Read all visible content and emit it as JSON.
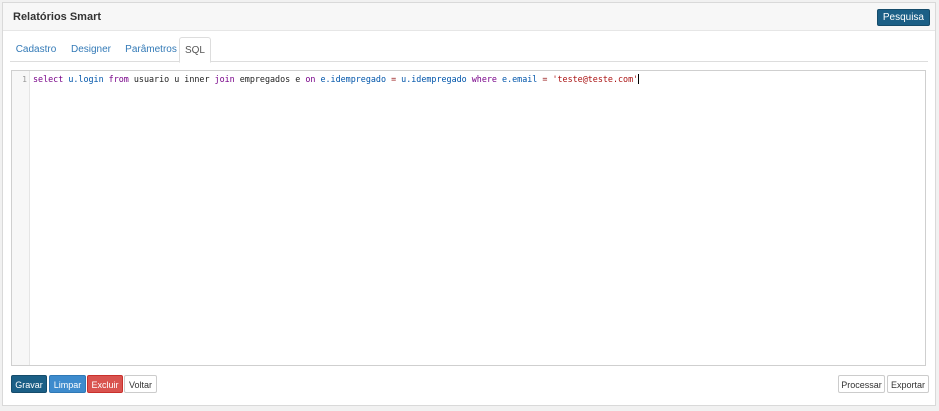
{
  "header": {
    "title": "Relatórios Smart",
    "search_button": "Pesquisa"
  },
  "tabs": [
    {
      "label": "Cadastro",
      "active": false
    },
    {
      "label": "Designer",
      "active": false
    },
    {
      "label": "Parâmetros",
      "active": false
    },
    {
      "label": "SQL",
      "active": true
    }
  ],
  "editor": {
    "line_number": "1",
    "tokens": [
      {
        "text": "select",
        "kind": "kw"
      },
      {
        "text": " ",
        "kind": "plain"
      },
      {
        "text": "u.login",
        "kind": "var"
      },
      {
        "text": " ",
        "kind": "plain"
      },
      {
        "text": "from",
        "kind": "kw"
      },
      {
        "text": " usuario u inner ",
        "kind": "plain"
      },
      {
        "text": "join",
        "kind": "kw"
      },
      {
        "text": " empregados e ",
        "kind": "plain"
      },
      {
        "text": "on",
        "kind": "kw"
      },
      {
        "text": " ",
        "kind": "plain"
      },
      {
        "text": "e.idempregado",
        "kind": "var"
      },
      {
        "text": " ",
        "kind": "plain"
      },
      {
        "text": "=",
        "kind": "op"
      },
      {
        "text": " ",
        "kind": "plain"
      },
      {
        "text": "u.idempregado",
        "kind": "var"
      },
      {
        "text": " ",
        "kind": "plain"
      },
      {
        "text": "where",
        "kind": "kw"
      },
      {
        "text": " ",
        "kind": "plain"
      },
      {
        "text": "e.email",
        "kind": "var"
      },
      {
        "text": " ",
        "kind": "plain"
      },
      {
        "text": "=",
        "kind": "op"
      },
      {
        "text": " ",
        "kind": "plain"
      },
      {
        "text": "'teste@teste.com'",
        "kind": "str"
      }
    ]
  },
  "footer": {
    "gravar": "Gravar",
    "limpar": "Limpar",
    "excluir": "Excluir",
    "voltar": "Voltar",
    "processar": "Processar",
    "exportar": "Exportar"
  }
}
